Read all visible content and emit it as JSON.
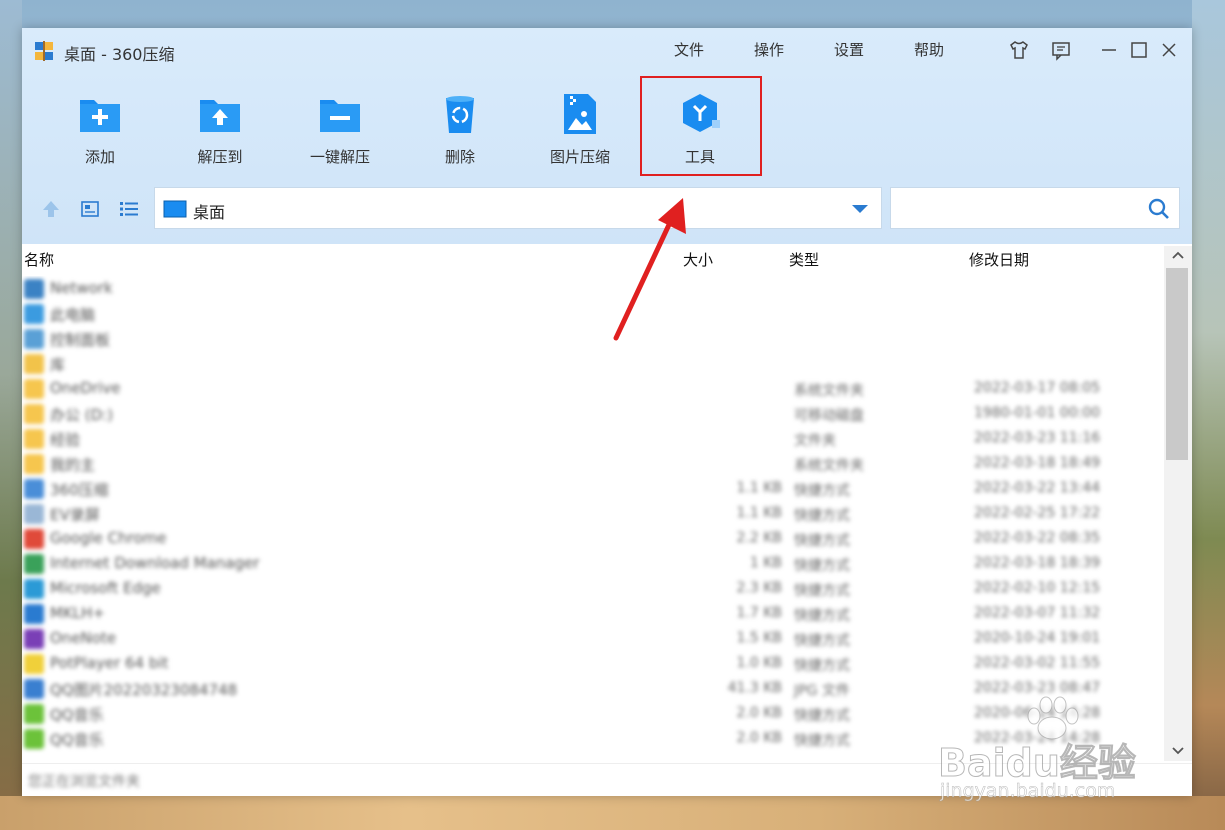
{
  "window": {
    "title": "桌面 - 360压缩"
  },
  "menu": [
    "文件",
    "操作",
    "设置",
    "帮助"
  ],
  "toolbar": [
    {
      "label": "添加",
      "icon": "add-folder-icon"
    },
    {
      "label": "解压到",
      "icon": "extract-to-folder-icon"
    },
    {
      "label": "一键解压",
      "icon": "one-click-extract-icon"
    },
    {
      "label": "删除",
      "icon": "delete-bin-icon"
    },
    {
      "label": "图片压缩",
      "icon": "image-compress-icon"
    },
    {
      "label": "工具",
      "icon": "tools-cube-icon"
    }
  ],
  "path": {
    "current": "桌面"
  },
  "search": {
    "placeholder": ""
  },
  "columns": [
    "名称",
    "大小",
    "类型",
    "修改日期"
  ],
  "files": [
    {
      "name": "Network",
      "size": "",
      "type": "",
      "date": "",
      "color": "#3b82c4"
    },
    {
      "name": "此电脑",
      "size": "",
      "type": "",
      "date": "",
      "color": "#3b9be0"
    },
    {
      "name": "控制面板",
      "size": "",
      "type": "",
      "date": "",
      "color": "#5aa0d6"
    },
    {
      "name": "库",
      "size": "",
      "type": "",
      "date": "",
      "color": "#f2c34a"
    },
    {
      "name": "OneDrive",
      "size": "",
      "type": "系统文件夹",
      "date": "2022-03-17 08:05",
      "color": "#f6c64e"
    },
    {
      "name": "办公 (D:)",
      "size": "",
      "type": "可移动磁盘",
      "date": "1980-01-01 00:00",
      "color": "#f6c64e"
    },
    {
      "name": "经验",
      "size": "",
      "type": "文件夹",
      "date": "2022-03-23 11:16",
      "color": "#f6c64e"
    },
    {
      "name": "我的主",
      "size": "",
      "type": "系统文件夹",
      "date": "2022-03-18 18:49",
      "color": "#f6c64e"
    },
    {
      "name": "360压缩",
      "size": "1.1 KB",
      "type": "快捷方式",
      "date": "2022-03-22 13:44",
      "color": "#4a8ed8"
    },
    {
      "name": "EV录屏",
      "size": "1.1 KB",
      "type": "快捷方式",
      "date": "2022-02-25 17:22",
      "color": "#9ab7d6"
    },
    {
      "name": "Google Chrome",
      "size": "2.2 KB",
      "type": "快捷方式",
      "date": "2022-03-22 08:35",
      "color": "#e04a3a"
    },
    {
      "name": "Internet Download Manager",
      "size": "1 KB",
      "type": "快捷方式",
      "date": "2022-03-18 18:39",
      "color": "#3aa15a"
    },
    {
      "name": "Microsoft Edge",
      "size": "2.3 KB",
      "type": "快捷方式",
      "date": "2022-02-10 12:15",
      "color": "#2b9ad6"
    },
    {
      "name": "MKLH+",
      "size": "1.7 KB",
      "type": "快捷方式",
      "date": "2022-03-07 11:32",
      "color": "#2a7bd0"
    },
    {
      "name": "OneNote",
      "size": "1.5 KB",
      "type": "快捷方式",
      "date": "2020-10-24 19:01",
      "color": "#7a3fb6"
    },
    {
      "name": "PotPlayer 64 bit",
      "size": "1.0 KB",
      "type": "快捷方式",
      "date": "2022-03-02 11:55",
      "color": "#f0d03a"
    },
    {
      "name": "QQ图片20220323084748",
      "size": "41.3 KB",
      "type": "JPG 文件",
      "date": "2022-03-23 08:47",
      "color": "#3a7fd0"
    },
    {
      "name": "QQ音乐",
      "size": "2.0 KB",
      "type": "快捷方式",
      "date": "2020-06-14 14:28",
      "color": "#6cc23a"
    },
    {
      "name": "QQ音乐",
      "size": "2.0 KB",
      "type": "快捷方式",
      "date": "2022-03-24 14:28",
      "color": "#6cc23a"
    }
  ],
  "status": "您正在浏览文件夹",
  "watermark": {
    "brand": "Baidu经验",
    "url": "jingyan.baidu.com"
  },
  "colors": {
    "accent": "#1a8cf0",
    "highlight": "#e02020",
    "titlebar_bg": "#d9ebfb"
  }
}
